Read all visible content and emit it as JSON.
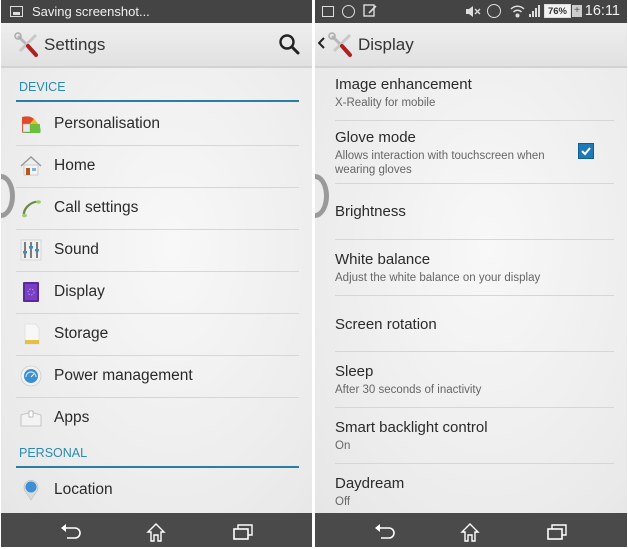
{
  "left_screen": {
    "status_bar": {
      "notification_icon": "screenshot-icon",
      "notification_text": "Saving screenshot..."
    },
    "action_bar": {
      "app_icon": "settings-tools-icon",
      "title": "Settings",
      "search_icon": "search-icon"
    },
    "sections": [
      {
        "header": "DEVICE",
        "items": [
          {
            "label": "Personalisation",
            "icon": "personalisation-icon"
          },
          {
            "label": "Home",
            "icon": "home-icon"
          },
          {
            "label": "Call settings",
            "icon": "phone-handset-icon"
          },
          {
            "label": "Sound",
            "icon": "equalizer-sliders-icon"
          },
          {
            "label": "Display",
            "icon": "display-icon"
          },
          {
            "label": "Storage",
            "icon": "sd-card-icon"
          },
          {
            "label": "Power management",
            "icon": "battery-gauge-icon"
          },
          {
            "label": "Apps",
            "icon": "apps-box-icon"
          }
        ]
      },
      {
        "header": "PERSONAL",
        "items": [
          {
            "label": "Location",
            "icon": "location-pin-icon"
          }
        ]
      }
    ]
  },
  "right_screen": {
    "status_bar": {
      "left_icons": [
        "screenshot-icon",
        "alarm-clock-icon",
        "note-edit-icon"
      ],
      "right_icons": [
        "mute-icon",
        "alarm-icon",
        "wifi-icon",
        "signal-icon"
      ],
      "battery_percent": "76%",
      "battery_level": 0.76,
      "time": "16:11"
    },
    "action_bar": {
      "back_icon": "chevron-left-icon",
      "app_icon": "settings-tools-icon",
      "title": "Display"
    },
    "items": [
      {
        "title": "Image enhancement",
        "summary": "X-Reality for mobile"
      },
      {
        "title": "Glove mode",
        "summary": "Allows interaction with touchscreen when wearing gloves",
        "checked": true
      },
      {
        "title": "Brightness",
        "summary": ""
      },
      {
        "title": "White balance",
        "summary": "Adjust the white balance on your display"
      },
      {
        "title": "Screen rotation",
        "summary": ""
      },
      {
        "title": "Sleep",
        "summary": "After 30 seconds of inactivity"
      },
      {
        "title": "Smart backlight control",
        "summary": "On"
      },
      {
        "title": "Daydream",
        "summary": "Off"
      }
    ]
  },
  "nav_bar": {
    "back": "back-icon",
    "home": "home-icon",
    "recents": "recent-apps-icon"
  },
  "colors": {
    "accent": "#2c8ab0",
    "checkbox": "#1e7bb8",
    "status_bar": "#444444",
    "nav_bar": "#4a4a4a"
  }
}
